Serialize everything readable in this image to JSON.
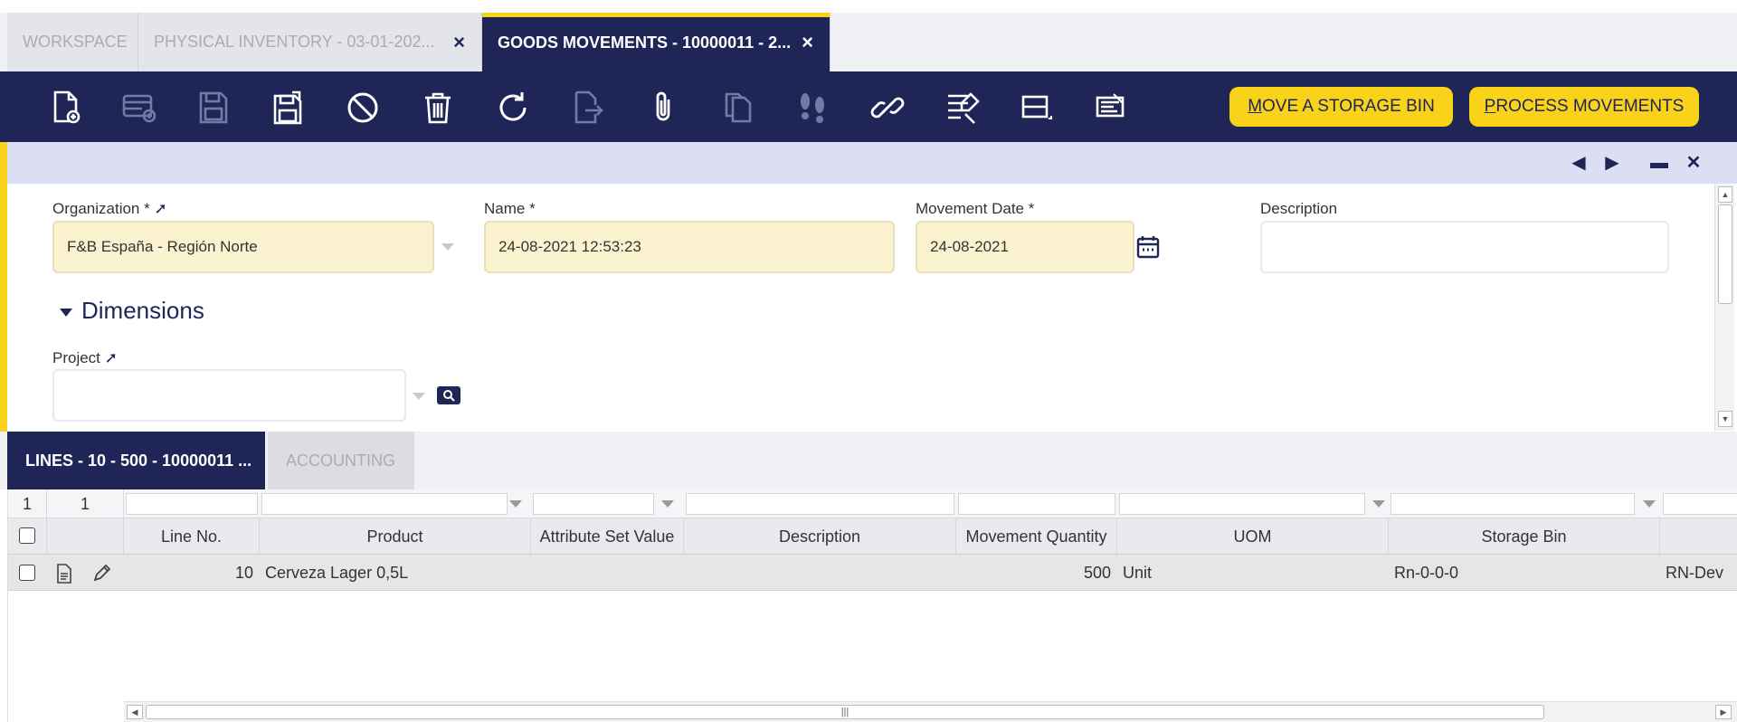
{
  "window_tabs": [
    {
      "label": "WORKSPACE"
    },
    {
      "label": "PHYSICAL INVENTORY - 03-01-202...",
      "close": "×"
    },
    {
      "label": "GOODS MOVEMENTS - 10000011 - 2...",
      "close": "×"
    }
  ],
  "toolbar": {
    "icons": [
      "new-document-icon",
      "new-record-icon",
      "save-icon",
      "save-close-icon",
      "cancel-icon",
      "delete-icon",
      "refresh-icon",
      "export-icon",
      "attachment-icon",
      "clone-icon",
      "audit-trail-icon",
      "link-icon",
      "tree-icon",
      "form-grid-toggle-icon",
      "print-icon"
    ],
    "move_bin": {
      "accel": "M",
      "rest": "OVE A STORAGE BIN"
    },
    "process": {
      "accel": "P",
      "rest": "ROCESS MOVEMENTS"
    }
  },
  "header_nav": {
    "prev": "◀",
    "next": "▶",
    "maximize": "▬",
    "close": "✕"
  },
  "form": {
    "organization": {
      "label": "Organization *",
      "value": "F&B España - Región Norte"
    },
    "name": {
      "label": "Name *",
      "value": "24-08-2021 12:53:23"
    },
    "movement_date": {
      "label": "Movement Date *",
      "value": "24-08-2021"
    },
    "description": {
      "label": "Description",
      "value": ""
    },
    "dimensions_title": "Dimensions",
    "project": {
      "label": "Project",
      "value": ""
    }
  },
  "lower_tabs": [
    {
      "label": "LINES - 10 - 500 - 10000011 ..."
    },
    {
      "label": "ACCOUNTING"
    }
  ],
  "grid": {
    "counters": [
      "1",
      "1"
    ],
    "columns": [
      "Line No.",
      "Product",
      "Attribute Set Value",
      "Description",
      "Movement Quantity",
      "UOM",
      "Storage Bin"
    ],
    "rows": [
      {
        "line_no": "10",
        "product": "Cerveza Lager 0,5L",
        "attribute_set": "",
        "description": "",
        "movement_quantity": "500",
        "uom": "Unit",
        "storage_bin": "Rn-0-0-0",
        "next": "RN-Dev"
      }
    ]
  },
  "colors": {
    "navy": "#1f2557",
    "yellow": "#f9d21a",
    "required_field": "#fbf3d0"
  }
}
